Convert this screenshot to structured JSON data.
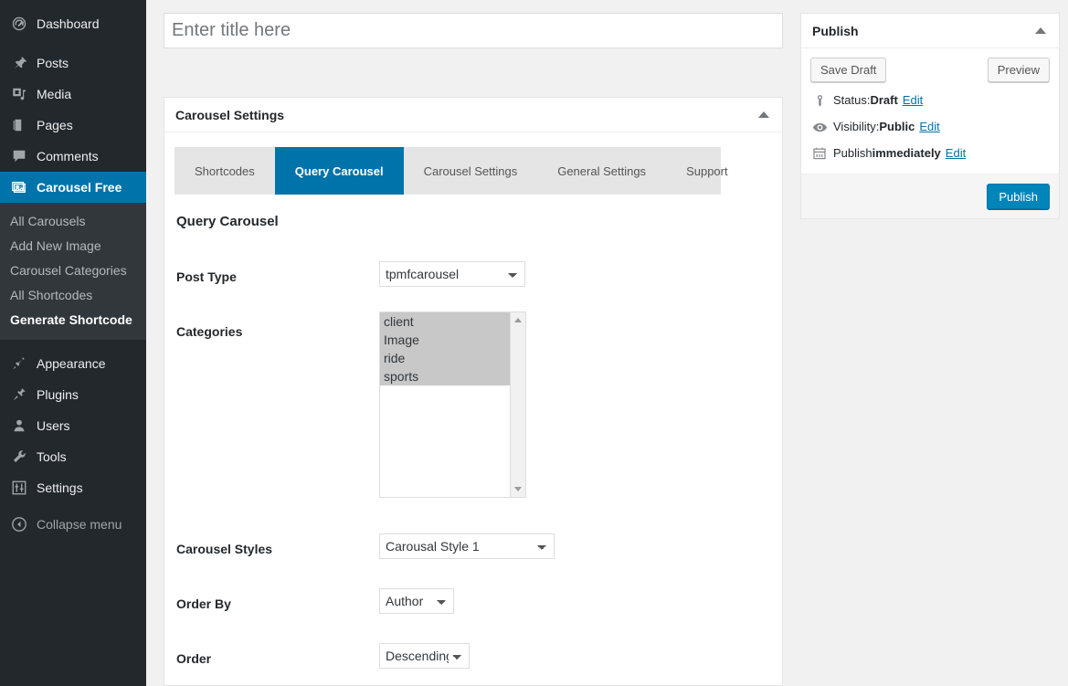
{
  "sidebar": {
    "items": [
      {
        "label": "Dashboard",
        "icon": "dashboard-icon",
        "current": false
      },
      {
        "label": "Posts",
        "icon": "pin-icon",
        "current": false
      },
      {
        "label": "Media",
        "icon": "media-icon",
        "current": false
      },
      {
        "label": "Pages",
        "icon": "pages-icon",
        "current": false
      },
      {
        "label": "Comments",
        "icon": "comments-icon",
        "current": false
      },
      {
        "label": "Carousel Free",
        "icon": "images-icon",
        "current": true
      }
    ],
    "submenu": [
      {
        "label": "All Carousels",
        "current": false
      },
      {
        "label": "Add New Image",
        "current": false
      },
      {
        "label": "Carousel Categories",
        "current": false
      },
      {
        "label": "All Shortcodes",
        "current": false
      },
      {
        "label": "Generate Shortcode",
        "current": true
      }
    ],
    "items_lower": [
      {
        "label": "Appearance",
        "icon": "brush-icon"
      },
      {
        "label": "Plugins",
        "icon": "plug-icon"
      },
      {
        "label": "Users",
        "icon": "user-icon"
      },
      {
        "label": "Tools",
        "icon": "wrench-icon"
      },
      {
        "label": "Settings",
        "icon": "sliders-icon"
      }
    ],
    "collapse": {
      "label": "Collapse menu",
      "icon": "collapse-icon"
    },
    "accent_color": "#0073aa",
    "background_color": "#23282d",
    "submenu_background_color": "#32373c"
  },
  "editor": {
    "title_value": "",
    "title_placeholder": "Enter title here"
  },
  "metabox": {
    "title": "Carousel Settings",
    "toggle_icon": "triangle-up-icon",
    "tabs": [
      {
        "label": "Shortcodes",
        "active": false
      },
      {
        "label": "Query Carousel",
        "active": true
      },
      {
        "label": "Carousel Settings",
        "active": false
      },
      {
        "label": "General Settings",
        "active": false
      },
      {
        "label": "Support",
        "active": false
      }
    ],
    "pane_title": "Query Carousel",
    "fields": {
      "post_type": {
        "label": "Post Type",
        "value": "tpmfcarousel",
        "options": [
          "tpmfcarousel"
        ]
      },
      "categories": {
        "label": "Categories",
        "options": [
          {
            "label": "client",
            "selected": true
          },
          {
            "label": "Image",
            "selected": true
          },
          {
            "label": "ride",
            "selected": true
          },
          {
            "label": "sports",
            "selected": true
          }
        ]
      },
      "carousel_styles": {
        "label": "Carousel Styles",
        "value": "Carousal Style 1",
        "options": [
          "Carousal Style 1"
        ]
      },
      "order_by": {
        "label": "Order By",
        "value": "Author",
        "options": [
          "Author"
        ]
      },
      "order": {
        "label": "Order",
        "value": "Descending",
        "options": [
          "Descending"
        ]
      }
    }
  },
  "publish": {
    "title": "Publish",
    "toggle_icon": "triangle-up-icon",
    "save_draft_label": "Save Draft",
    "preview_label": "Preview",
    "status": {
      "icon": "key-icon",
      "prefix": "Status: ",
      "value": "Draft",
      "edit_label": "Edit"
    },
    "visibility": {
      "icon": "eye-icon",
      "prefix": "Visibility: ",
      "value": "Public",
      "edit_label": "Edit"
    },
    "schedule": {
      "icon": "calendar-icon",
      "prefix": "Publish ",
      "value": "immediately",
      "edit_label": "Edit"
    },
    "publish_label": "Publish",
    "primary_color": "#0085ba"
  }
}
